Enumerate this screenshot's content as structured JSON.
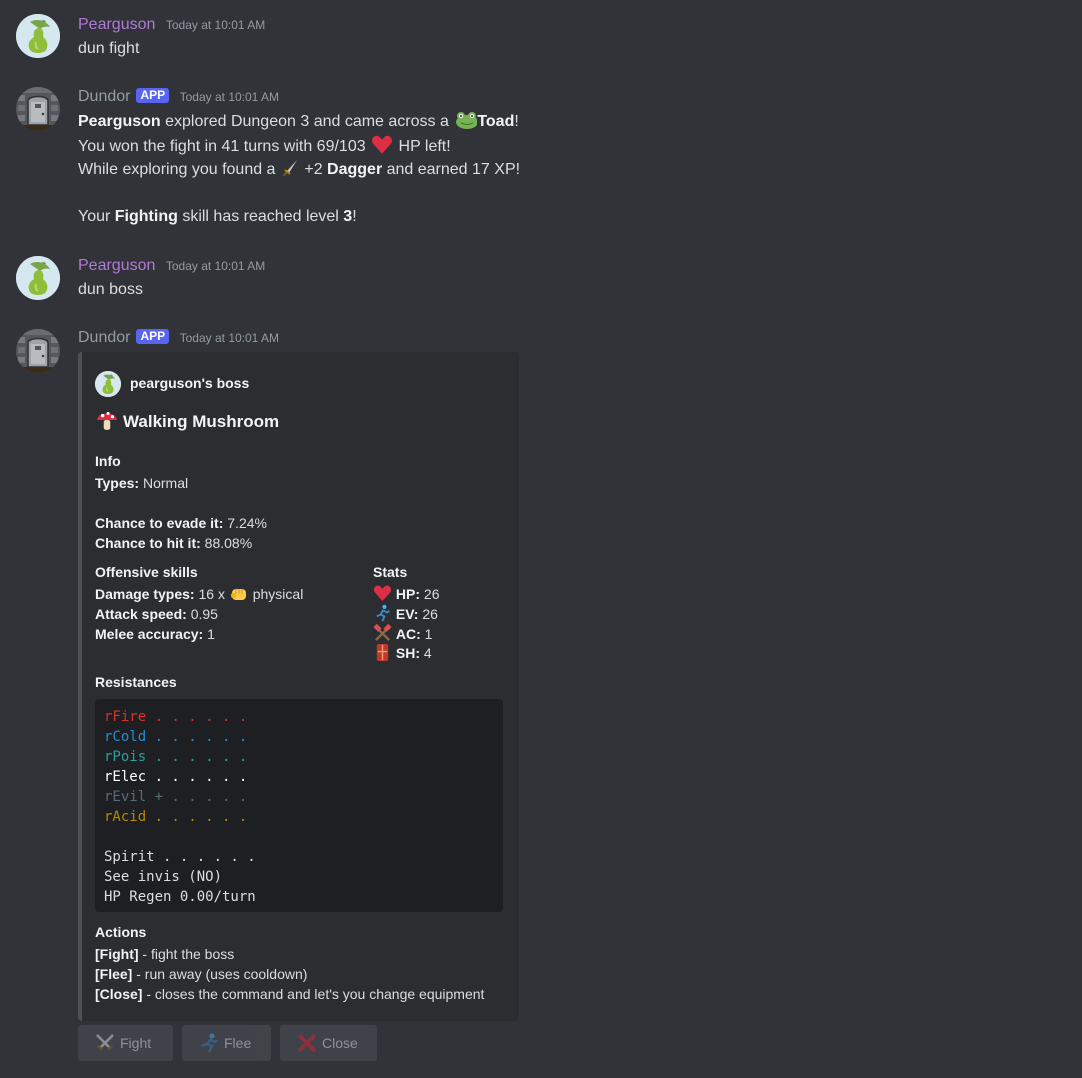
{
  "messages": [
    {
      "author": "Pearguson",
      "timestamp": "Today at 10:01 AM",
      "avatar_icon": "pear-avatar",
      "content": "dun fight"
    },
    {
      "author": "Dundor",
      "badge": "APP",
      "timestamp": "Today at 10:01 AM",
      "avatar_icon": "door-avatar",
      "lines": {
        "l1": {
          "bold_name": "Pearguson",
          "text_a": " explored Dungeon 3 and came across a ",
          "monster": "Toad",
          "text_b": "!"
        },
        "l2": {
          "text_a": "You won the fight in 41 turns with 69/103 ",
          "text_b": " HP left!"
        },
        "l3": {
          "text_a": "While exploring you found a ",
          "text_b": " +2 ",
          "item": "Dagger",
          "text_c": " and earned 17 XP!"
        },
        "l4": {
          "text_a": "Your ",
          "skill": "Fighting",
          "text_b": " skill has reached level ",
          "level": "3",
          "text_c": "!"
        }
      }
    },
    {
      "author": "Pearguson",
      "timestamp": "Today at 10:01 AM",
      "avatar_icon": "pear-avatar",
      "content": "dun boss"
    },
    {
      "author": "Dundor",
      "badge": "APP",
      "timestamp": "Today at 10:01 AM",
      "avatar_icon": "door-avatar"
    }
  ],
  "embed": {
    "author": "pearguson's boss",
    "title": "Walking Mushroom",
    "info_header": "Info",
    "types_label": "Types:",
    "types_value": " Normal",
    "evade_label": "Chance to evade it:",
    "evade_value": " 7.24%",
    "hit_label": "Chance to hit it:",
    "hit_value": " 88.08%",
    "offensive_header": "Offensive skills",
    "damage_label": "Damage types:",
    "damage_value": " 16 x ",
    "damage_type": " physical",
    "speed_label": "Attack speed:",
    "speed_value": " 0.95",
    "accuracy_label": "Melee accuracy:",
    "accuracy_value": " 1",
    "stats_header": "Stats",
    "stats": [
      {
        "label": "HP:",
        "value": " 26",
        "icon": "heart-icon"
      },
      {
        "label": "EV:",
        "value": " 26",
        "icon": "running-icon"
      },
      {
        "label": "AC:",
        "value": " 1",
        "icon": "crossed-hammers-icon"
      },
      {
        "label": "SH:",
        "value": " 4",
        "icon": "shield-icon"
      }
    ],
    "resist_header": "Resistances",
    "resistances": [
      {
        "text": "rFire . . . . . .",
        "color": "#dc322f"
      },
      {
        "text": "rCold . . . . . .",
        "color": "#268bd2"
      },
      {
        "text": "rPois . . . . . .",
        "color": "#2aa198"
      },
      {
        "text": "rElec . . . . . .",
        "color": "#ffffff"
      },
      {
        "text": "rEvil + . . . . .",
        "color": "#586e75"
      },
      {
        "text": "rAcid . . . . . .",
        "color": "#b58900"
      }
    ],
    "extra_lines": [
      "Spirit . . . . . .",
      "See invis (NO)",
      "HP Regen 0.00/turn"
    ],
    "actions_header": "Actions",
    "actions": [
      {
        "label": "[Fight]",
        "desc": " - fight the boss"
      },
      {
        "label": "[Flee]",
        "desc": " - run away (uses cooldown)"
      },
      {
        "label": "[Close]",
        "desc": " - closes the command and let's you change equipment"
      }
    ]
  },
  "buttons": [
    {
      "label": "Fight",
      "icon": "crossed-swords-icon"
    },
    {
      "label": "Flee",
      "icon": "running-icon"
    },
    {
      "label": "Close",
      "icon": "red-x-icon"
    }
  ],
  "colors": {
    "background": "#313338",
    "embed_bg": "#2b2d31",
    "pear_name": "#b07ad6",
    "app_badge": "#5865f2"
  }
}
